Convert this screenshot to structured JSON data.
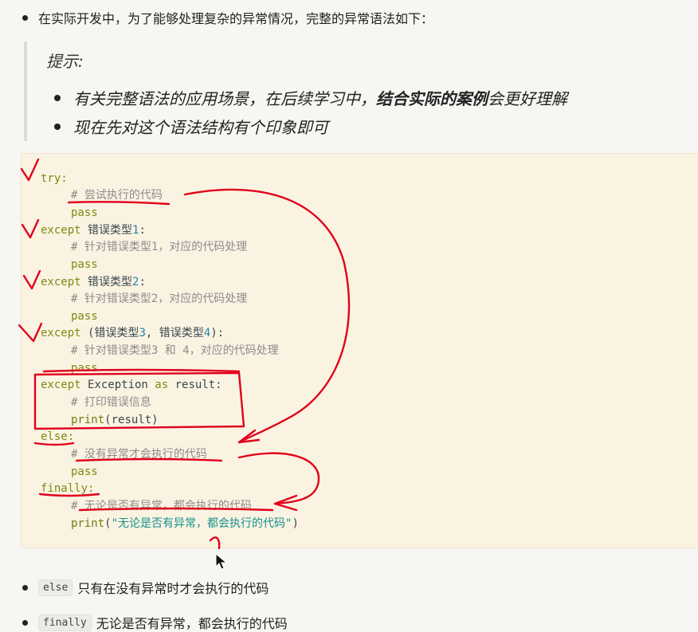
{
  "intro": "在实际开发中，为了能够处理复杂的异常情况，完整的异常语法如下：",
  "tip": {
    "title": "提示:",
    "items": [
      {
        "pre": "有关完整语法的应用场景，在后续学习中，",
        "bold": "结合实际的案例",
        "post": "会更好理解"
      },
      {
        "pre": "现在先对这个语法结构有个印象即可",
        "bold": "",
        "post": ""
      }
    ]
  },
  "code": {
    "try": "try:",
    "c1": "# 尝试执行的代码",
    "pass": "pass",
    "except": "except",
    "t1": "错误类型",
    "n1": "1",
    "colon": ":",
    "c2": "# 针对错误类型1，对应的代码处理",
    "n2": "2",
    "c3": "# 针对错误类型2，对应的代码处理",
    "paren_open": "(",
    "n3": "3",
    "comma": ", ",
    "n4": "4",
    "paren_close": "):",
    "c4": "# 针对错误类型3 和 4，对应的代码处理",
    "exc_mid": " Exception ",
    "as": "as",
    "exc_end": " result:",
    "c5": "# 打印错误信息",
    "print1_fn": "print",
    "print1_args": "(result)",
    "else": "else:",
    "c6": "# 没有异常才会执行的代码",
    "finally": "finally:",
    "c7": "# 无论是否有异常，都会执行的代码",
    "print2_fn": "print",
    "p_open": "(",
    "print2_str": "\"无论是否有异常，都会执行的代码\"",
    "p_close": ")"
  },
  "bullets": [
    {
      "code": "else",
      "text": "只有在没有异常时才会执行的代码"
    },
    {
      "code": "finally",
      "text": "无论是否有异常，都会执行的代码"
    }
  ],
  "colors": {
    "keyword": "#7b8a12",
    "comment": "#8c8c8c",
    "string": "#16938c",
    "annotation": "#e0001b",
    "code_background": "#fbf3e2"
  }
}
